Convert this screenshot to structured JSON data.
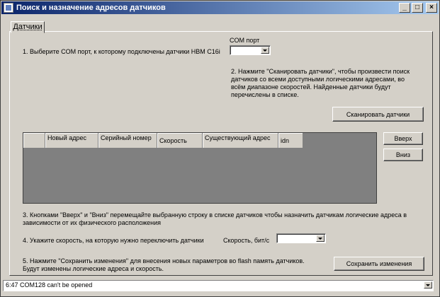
{
  "window": {
    "title": "Поиск и назначение адресов датчиков",
    "min": "_",
    "max": "□",
    "close": "×"
  },
  "tabs": [
    {
      "label": "Датчики"
    }
  ],
  "step1": "1. Выберите COM порт, к которому подключены датчики НВМ C16i",
  "com_port": {
    "label": "COM порт",
    "value": ""
  },
  "step2": "2. Нажмите \"Сканировать датчики\", чтобы произвести поиск датчиков со всеми доступными логическими адресами, во всём диапазоне скоростей. Найденные датчики будут перечислены в списке.",
  "scan_button": "Сканировать датчики",
  "table": {
    "headers": [
      "",
      "Новый адрес",
      "Серийный номер",
      "Скорость",
      "Существующий адрес",
      "idn"
    ],
    "rows": []
  },
  "up_button": "Вверх",
  "down_button": "Вниз",
  "step3": "3. Кнопками \"Вверх\" и \"Вниз\" перемещайте выбранную строку в списке датчиков чтобы назначить датчикам логические адреса в зависимости от их физического расположения",
  "step4": "4. Укажите скорость, на которую нужно переключить датчики",
  "speed": {
    "label": "Скорость, бит/с",
    "value": ""
  },
  "step5": "5. Нажмите \"Сохранить изменения\" для внесения новых параметров во flash память датчиков. Будут изменены логические адреса и скорость.",
  "save_button": "Сохранить изменения",
  "status": {
    "text": "6:47 COM128 can't be opened"
  }
}
